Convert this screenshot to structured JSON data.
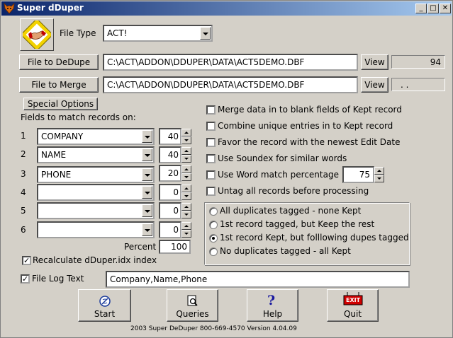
{
  "title": "Super dDuper",
  "file_type": {
    "label": "File Type",
    "value": "ACT!"
  },
  "dedupe": {
    "button": "File to DeDupe",
    "path": "C:\\ACT\\ADDON\\DDUPER\\DATA\\ACT5DEMO.DBF",
    "view": "View",
    "count": "94"
  },
  "merge": {
    "button": "File to Merge",
    "path": "C:\\ACT\\ADDON\\DDUPER\\DATA\\ACT5DEMO.DBF",
    "view": "View",
    "count": ". ."
  },
  "special_options": "Special Options",
  "fields_label": "Fields to match records on:",
  "match_fields": [
    {
      "num": "1",
      "field": "COMPANY",
      "len": "40"
    },
    {
      "num": "2",
      "field": "NAME",
      "len": "40"
    },
    {
      "num": "3",
      "field": "PHONE",
      "len": "20"
    },
    {
      "num": "4",
      "field": "",
      "len": "0"
    },
    {
      "num": "5",
      "field": "",
      "len": "0"
    },
    {
      "num": "6",
      "field": "",
      "len": "0"
    }
  ],
  "percent": {
    "label": "Percent",
    "value": "100"
  },
  "recalc": {
    "label": "Recalculate dDuper.idx index",
    "checked": true
  },
  "options": [
    {
      "label": "Merge data in to blank fields of Kept record",
      "checked": false
    },
    {
      "label": "Combine unique entries in to Kept record",
      "checked": false
    },
    {
      "label": "Favor the record with the newest Edit Date",
      "checked": false
    },
    {
      "label": "Use Soundex for similar words",
      "checked": false
    },
    {
      "label": "Use Word match percentage",
      "checked": false
    },
    {
      "label": "Untag all records before processing",
      "checked": false
    }
  ],
  "word_pct": "75",
  "tag_modes": [
    {
      "label": "All duplicates tagged - none Kept",
      "selected": false
    },
    {
      "label": "1st record tagged, but Keep the rest",
      "selected": false
    },
    {
      "label": "1st record Kept, but folllowing dupes tagged",
      "selected": true
    },
    {
      "label": "No duplicates tagged - all Kept",
      "selected": false
    }
  ],
  "log": {
    "label": "File Log Text",
    "checked": true,
    "value": "Company,Name,Phone"
  },
  "actions": [
    {
      "label": "Start",
      "icon": "start-icon"
    },
    {
      "label": "Queries",
      "icon": "queries-icon"
    },
    {
      "label": "Help",
      "icon": "help-icon"
    },
    {
      "label": "Quit",
      "icon": "exit-sign-icon"
    }
  ],
  "exit_sign_text": "EXIT",
  "help_glyph": "?",
  "footer": "2003  Super DeDuper    800-669-4570  Version     4.04.09",
  "colors": {
    "titlebar_start": "#0a246a",
    "titlebar_end": "#a6caf0",
    "face": "#d4d0c8"
  }
}
